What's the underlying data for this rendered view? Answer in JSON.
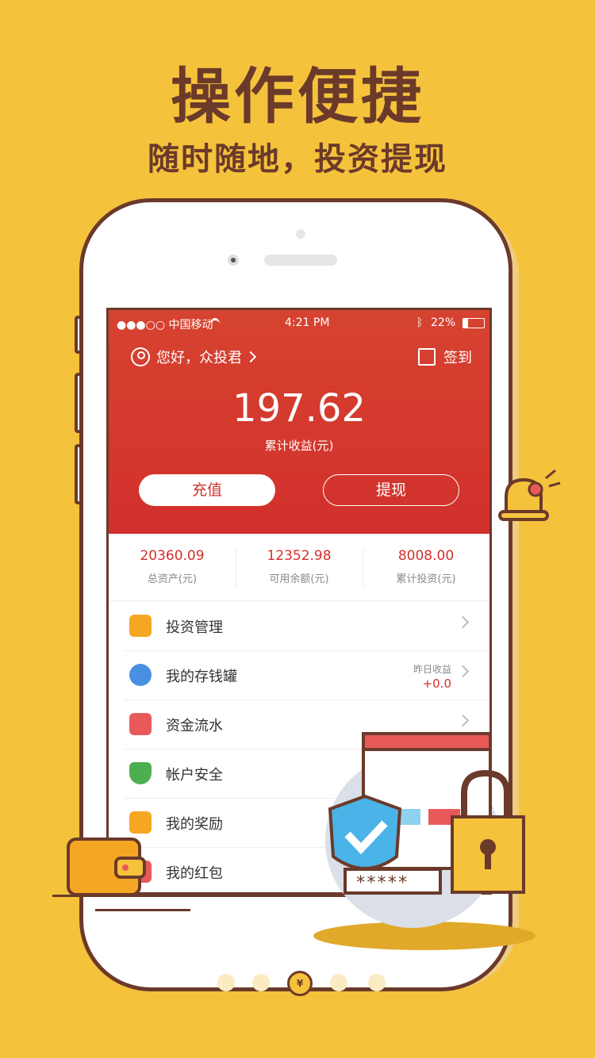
{
  "headline": "操作便捷",
  "subline": "随时随地，投资提现",
  "status_bar": {
    "carrier": "●●●○○ 中国移动",
    "time": "4:21 PM",
    "battery": "22%"
  },
  "header": {
    "greeting": "您好，众投君",
    "sign_in": "签到"
  },
  "earnings": {
    "value": "197.62",
    "label": "累计收益(元)"
  },
  "buttons": {
    "recharge": "充值",
    "withdraw": "提现"
  },
  "stats": [
    {
      "value": "20360.09",
      "label": "总资产(元)"
    },
    {
      "value": "12352.98",
      "label": "可用余额(元)"
    },
    {
      "value": "8008.00",
      "label": "累计投资(元)"
    }
  ],
  "menu": [
    {
      "label": "投资管理",
      "icon": "chart-icon",
      "color": "#F5A623"
    },
    {
      "label": "我的存钱罐",
      "icon": "piggy-bank-icon",
      "color": "#4A90E2",
      "extra_label": "昨日收益",
      "extra_value": "+0.0"
    },
    {
      "label": "资金流水",
      "icon": "ledger-icon",
      "color": "#E85A5A"
    },
    {
      "label": "帐户安全",
      "icon": "shield-icon",
      "color": "#4CAF50"
    },
    {
      "label": "我的奖励",
      "icon": "gift-icon",
      "color": "#F5A623"
    },
    {
      "label": "我的红包",
      "icon": "red-envelope-icon",
      "color": "#E85A5A"
    }
  ],
  "illustration": {
    "password_mask": "*****",
    "pager_icon": "¥"
  },
  "colors": {
    "background": "#F5C23B",
    "brand_red": "#D2302C",
    "outline": "#6B3A2A"
  }
}
